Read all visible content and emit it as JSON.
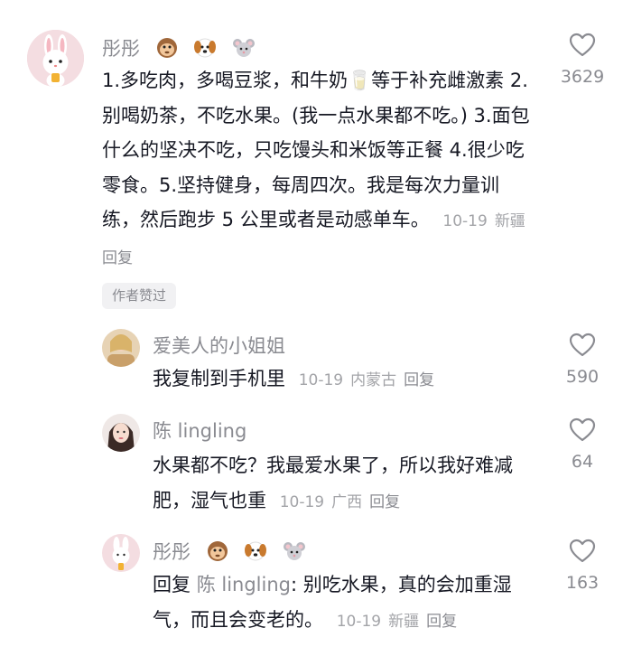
{
  "comments": [
    {
      "user": "彤彤",
      "text": "1.多吃肉，多喝豆浆，和牛奶🥛等于补充雌激素 2.别喝奶茶，不吃水果。(我一点水果都不吃。) 3.面包什么的坚决不吃，只吃馒头和米饭等正餐 4.很少吃零食。5.坚持健身，每周四次。我是每次力量训练，然后跑步 5 公里或者是动感单车。",
      "date": "10-19",
      "location": "新疆",
      "reply_label": "回复",
      "likes": "3629",
      "badge": "作者赞过"
    }
  ],
  "replies": [
    {
      "user": "爱美人的小姐姐",
      "text": "我复制到手机里",
      "date": "10-19",
      "location": "内蒙古",
      "reply_label": "回复",
      "likes": "590"
    },
    {
      "user": "陈 lingling",
      "text": "水果都不吃？我最爱水果了，所以我好难减肥，湿气也重",
      "date": "10-19",
      "location": "广西",
      "reply_label": "回复",
      "likes": "64"
    },
    {
      "user": "彤彤",
      "reply_prefix": "回复",
      "mention": "陈 lingling",
      "text": ": 别吃水果，真的会加重湿气，而且会变老的。",
      "date": "10-19",
      "location": "新疆",
      "reply_label": "回复",
      "likes": "163"
    }
  ],
  "icons": {
    "like": "heart-outline-icon",
    "emoji": [
      "monkey-icon",
      "dog-icon",
      "mouse-icon"
    ]
  }
}
